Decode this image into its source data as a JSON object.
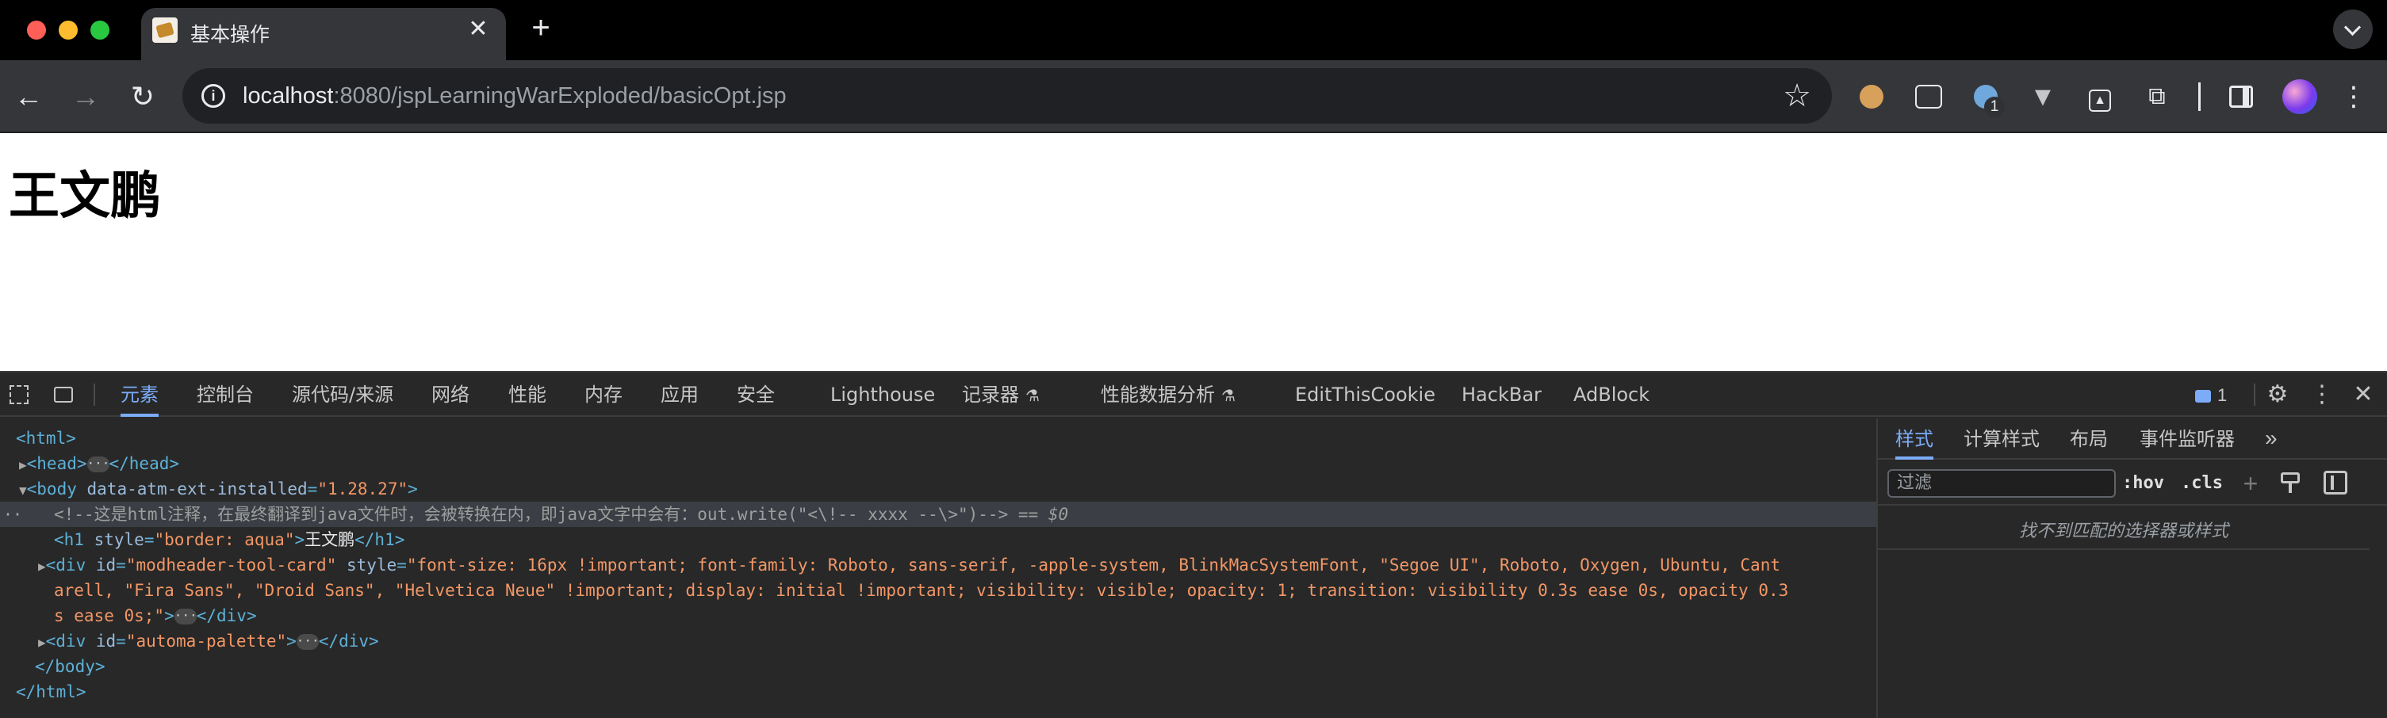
{
  "browser": {
    "tab": {
      "title": "基本操作",
      "close": "✕",
      "favicon": "jsp-favicon"
    },
    "new_tab": "+",
    "tab_search": "⌄",
    "url": {
      "host": "localhost",
      "rest": ":8080/jspLearningWarExploded/basicOpt.jsp"
    },
    "nav": {
      "back": "←",
      "forward": "→",
      "reload": "↻"
    },
    "site_info": "i",
    "bookmark_star": "☆",
    "extensions": {
      "modheader_badge": "1",
      "vue": "▼",
      "automa": "▲",
      "puzzle": "⧉",
      "menu": "⋮"
    }
  },
  "page": {
    "heading": "王文鹏"
  },
  "devtools": {
    "tabs": [
      {
        "label": "元素",
        "active": true
      },
      {
        "label": "控制台"
      },
      {
        "label": "源代码/来源"
      },
      {
        "label": "网络"
      },
      {
        "label": "性能"
      },
      {
        "label": "内存"
      },
      {
        "label": "应用"
      },
      {
        "label": "安全"
      },
      {
        "label": "Lighthouse"
      },
      {
        "label": "记录器"
      },
      {
        "label": "性能数据分析"
      },
      {
        "label": "EditThisCookie"
      },
      {
        "label": "HackBar"
      },
      {
        "label": "AdBlock"
      }
    ],
    "flask": "⚗",
    "issues_count": "1",
    "icons": {
      "gear": "⚙",
      "more": "⋮",
      "close": "✕"
    },
    "dom": {
      "html_open": "<html>",
      "head_open": "<head>",
      "head_close": "</head>",
      "body_tag": "<body",
      "body_attr": "data-atm-ext-installed",
      "body_attr_val": "\"1.28.27\"",
      "comment": "<!--这是html注释，在最终翻译到java文件时，会被转换在内，即java文字中会有：out.write(\"<\\!-- xxxx --\\>\")-->",
      "dollar_zero": "== $0",
      "h1_tag": "<h1",
      "h1_attr": "style",
      "h1_attr_val": "\"border: aqua\"",
      "h1_text": "王文鹏",
      "h1_close": "</h1>",
      "div1_tag": "<div",
      "div1_id_attr": "id",
      "div1_id_val": "\"modheader-tool-card\"",
      "div1_style_attr": "style",
      "div1_style_val_1": "\"font-size: 16px !important; font-family: Roboto, sans-serif, -apple-system, BlinkMacSystemFont, \"Segoe UI\", Roboto, Oxygen, Ubuntu, Cant",
      "div1_style_val_2": "arell, \"Fira Sans\", \"Droid Sans\", \"Helvetica Neue\" !important; display: initial !important; visibility: visible; opacity: 1; transition: visibility 0.3s ease 0s, opacity 0.3",
      "div1_style_val_3": "s ease 0s;\"",
      "div_close": "</div>",
      "div2_tag": "<div",
      "div2_id_attr": "id",
      "div2_id_val": "\"automa-palette\"",
      "body_close": "</body>",
      "html_close": "</html>",
      "ellipsis": "···",
      "gutter_dots": "··"
    },
    "styles_pane": {
      "tabs": [
        {
          "label": "样式",
          "active": true
        },
        {
          "label": "计算样式"
        },
        {
          "label": "布局"
        },
        {
          "label": "事件监听器"
        }
      ],
      "more": "»",
      "filter_placeholder": "过滤",
      "hov": ":hov",
      "cls": ".cls",
      "plus": "+",
      "empty_message": "找不到匹配的选择器或样式"
    }
  }
}
